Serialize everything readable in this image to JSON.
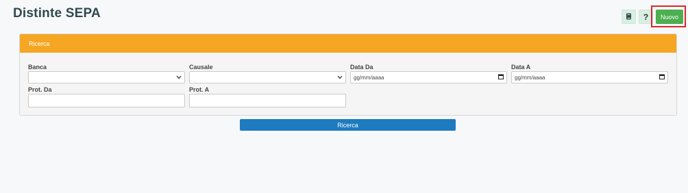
{
  "page": {
    "title": "Distinte SEPA"
  },
  "toolbar": {
    "book_icon": "book-icon",
    "help_label": "?",
    "new_label": "Nuovo"
  },
  "search_panel": {
    "header": "Ricerca",
    "fields": {
      "banca": {
        "label": "Banca",
        "value": ""
      },
      "causale": {
        "label": "Causale",
        "value": ""
      },
      "data_da": {
        "label": "Data Da",
        "placeholder": "gg/mm/aaaa"
      },
      "data_a": {
        "label": "Data A",
        "placeholder": "gg/mm/aaaa"
      },
      "prot_da": {
        "label": "Prot. Da",
        "value": ""
      },
      "prot_a": {
        "label": "Prot. A",
        "value": ""
      }
    },
    "search_button": "Ricerca"
  },
  "colors": {
    "panel_header": "#f5a623",
    "new_button": "#4caf50",
    "search_button": "#1e7bbf",
    "highlight": "#d9262a"
  }
}
